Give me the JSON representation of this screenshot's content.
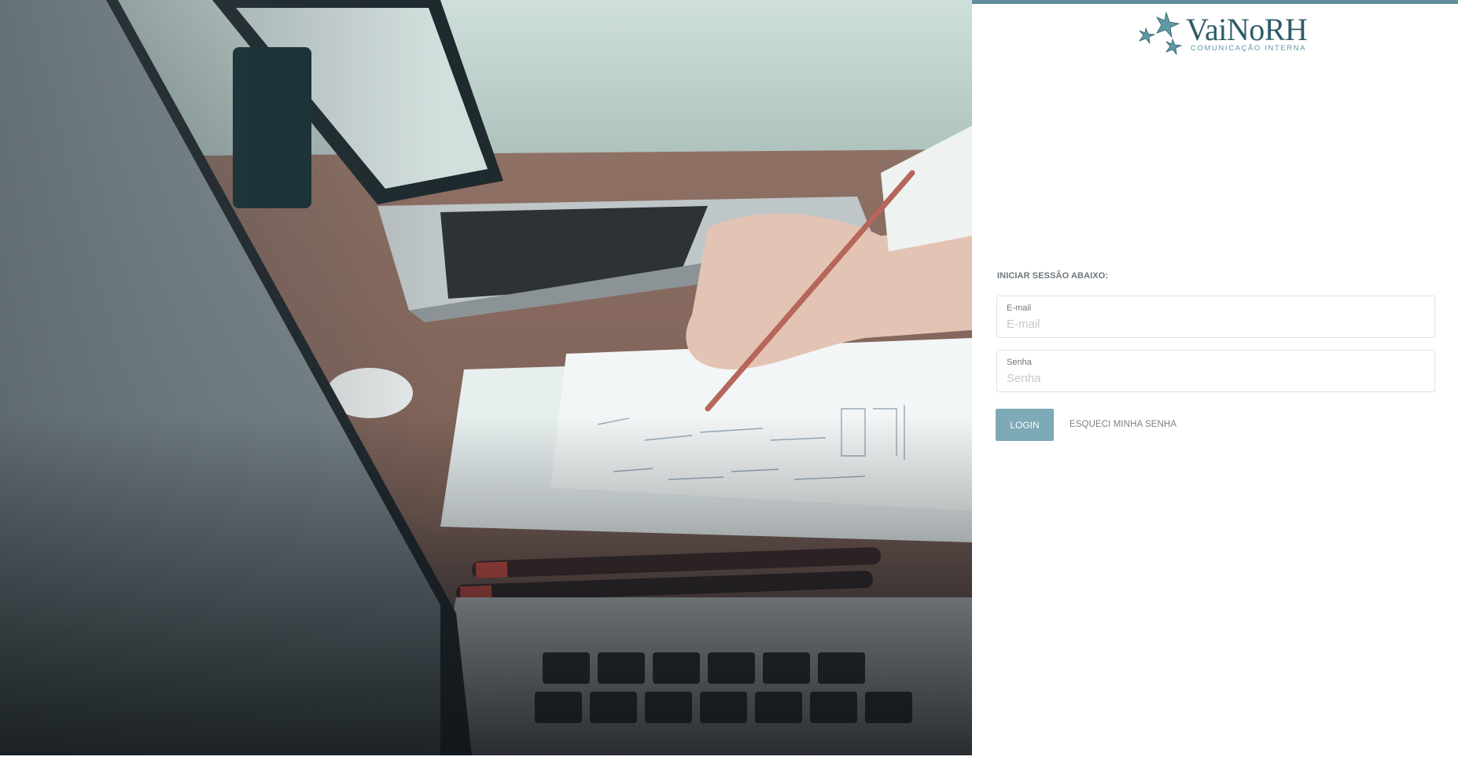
{
  "brand": {
    "name_part1": "Vai",
    "name_part2": "NoRH",
    "tagline": "COMUNICAÇÃO INTERNA",
    "color_dark": "#2f5c68",
    "color_accent": "#5c9aa6"
  },
  "theme": {
    "top_bar_color": "#5f8d99",
    "button_color": "#7ea9b6"
  },
  "login": {
    "section_title": "INICIAR SESSÃO ABAIXO:",
    "email": {
      "label": "E-mail",
      "placeholder": "E-mail",
      "value": ""
    },
    "senha": {
      "label": "Senha",
      "placeholder": "Senha",
      "value": ""
    },
    "login_button": "LOGIN",
    "forgot_link": "ESQUECI MINHA SENHA"
  }
}
